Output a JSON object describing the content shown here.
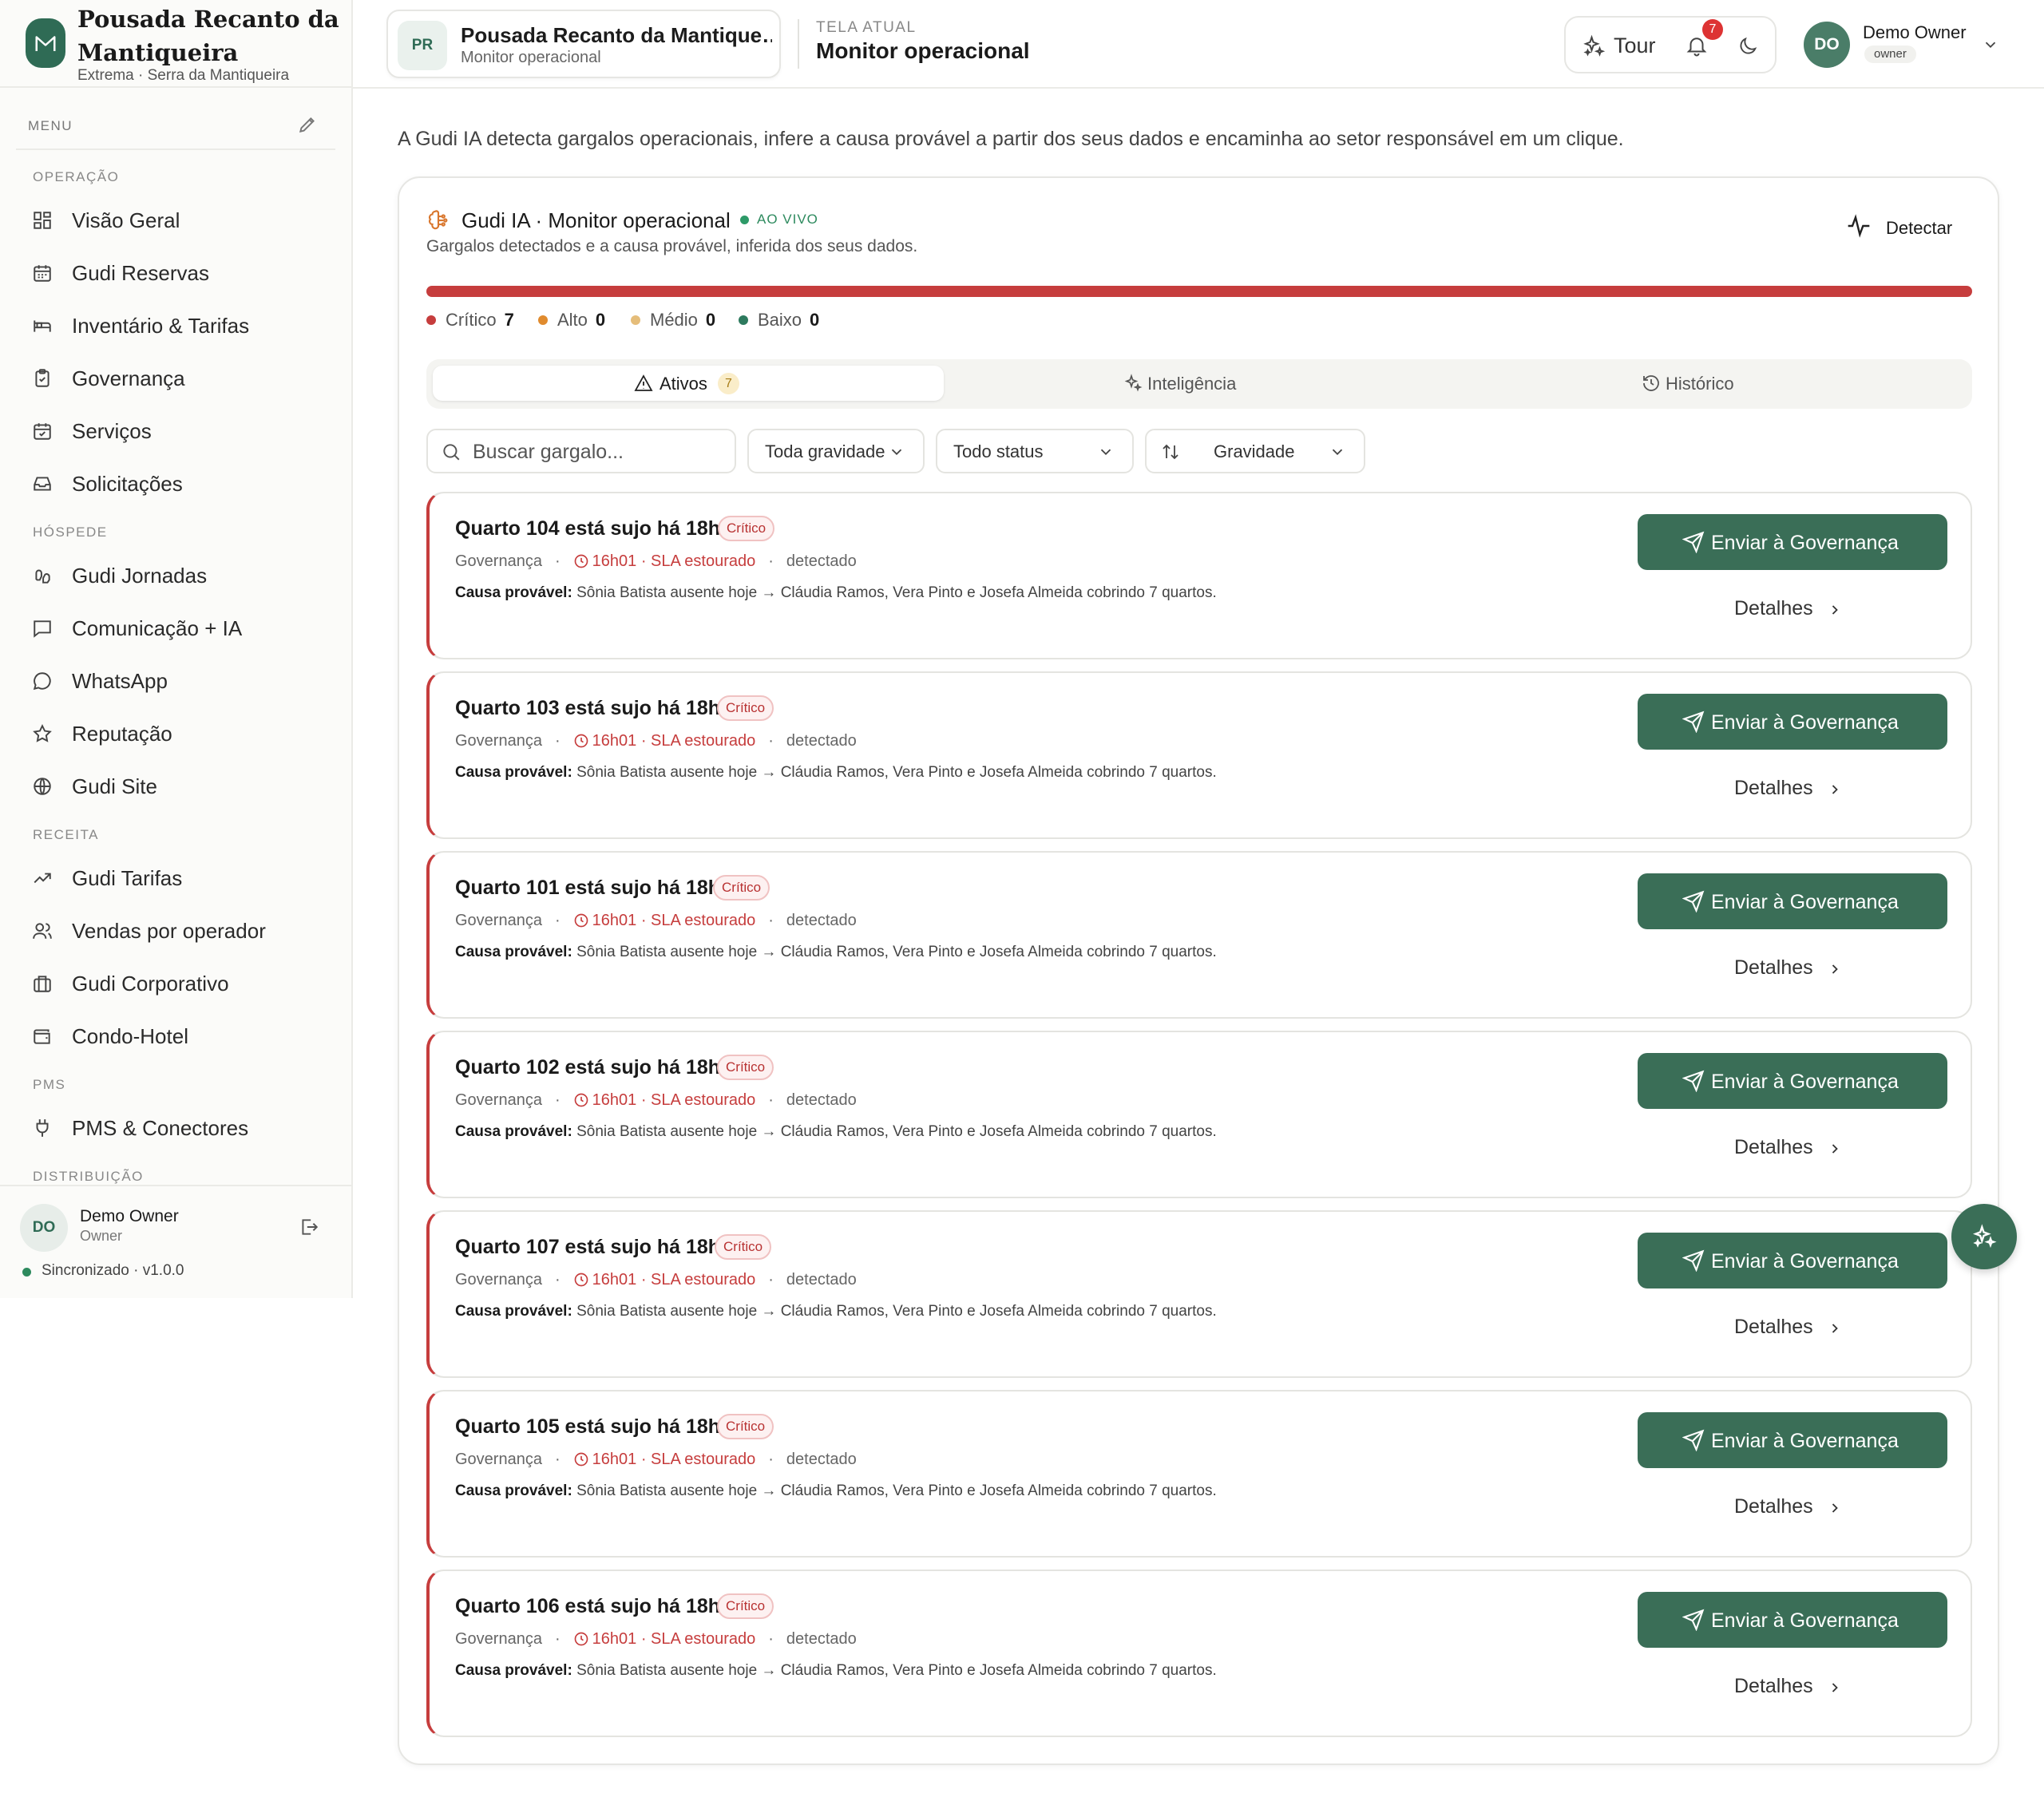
{
  "brand": {
    "name": "Pousada Recanto da Mantiqueira",
    "location": "Extrema · Serra da Mantiqueira"
  },
  "sidebar": {
    "menu_label": "MENU",
    "sections": {
      "operacao": "OPERAÇÃO",
      "hospede": "HÓSPEDE",
      "receita": "RECEITA",
      "pms": "PMS",
      "distribuicao": "DISTRIBUIÇÃO"
    },
    "items": [
      {
        "label": "Visão Geral",
        "icon": "grid-icon"
      },
      {
        "label": "Gudi Reservas",
        "icon": "calendar-icon"
      },
      {
        "label": "Inventário & Tarifas",
        "icon": "bed-icon"
      },
      {
        "label": "Governança",
        "icon": "clipboard-icon"
      },
      {
        "label": "Serviços",
        "icon": "calendar-check-icon"
      },
      {
        "label": "Solicitações",
        "icon": "inbox-icon"
      },
      {
        "label": "Gudi Jornadas",
        "icon": "footprints-icon"
      },
      {
        "label": "Comunicação + IA",
        "icon": "message-square-icon"
      },
      {
        "label": "WhatsApp",
        "icon": "message-circle-icon"
      },
      {
        "label": "Reputação",
        "icon": "star-icon"
      },
      {
        "label": "Gudi Site",
        "icon": "globe-icon"
      },
      {
        "label": "Gudi Tarifas",
        "icon": "trending-up-icon"
      },
      {
        "label": "Vendas por operador",
        "icon": "users-icon"
      },
      {
        "label": "Gudi Corporativo",
        "icon": "building-icon"
      },
      {
        "label": "Condo-Hotel",
        "icon": "wallet-icon"
      },
      {
        "label": "PMS & Conectores",
        "icon": "plug-icon"
      }
    ],
    "user": {
      "initials": "DO",
      "name": "Demo Owner",
      "role": "Owner"
    },
    "sync_status": "Sincronizado · v1.0.0"
  },
  "header": {
    "property_initials": "PR",
    "property_name": "Pousada Recanto da Mantique…",
    "property_sub": "Monitor operacional",
    "current_screen_label": "TELA ATUAL",
    "current_screen": "Monitor operacional",
    "tour_label": "Tour",
    "notifications_count": "7",
    "user_initials": "DO",
    "user_name": "Demo Owner",
    "user_role": "owner"
  },
  "main": {
    "intro": "A Gudi IA detecta gargalos operacionais, infere a causa provável a partir dos seus dados e encaminha ao setor responsável em um clique.",
    "panel": {
      "title": "Gudi IA · Monitor operacional",
      "live": "AO VIVO",
      "subtitle": "Gargalos detectados e a causa provável, inferida dos seus dados.",
      "detect_label": "Detectar",
      "severity": [
        {
          "label": "Crítico",
          "count": "7",
          "color": "#c63d3d"
        },
        {
          "label": "Alto",
          "count": "0",
          "color": "#e08b2e"
        },
        {
          "label": "Médio",
          "count": "0",
          "color": "#e5bd7a"
        },
        {
          "label": "Baixo",
          "count": "0",
          "color": "#2d7a5e"
        }
      ],
      "tabs": [
        {
          "label": "Ativos",
          "count": "7"
        },
        {
          "label": "Inteligência"
        },
        {
          "label": "Histórico"
        }
      ],
      "search_placeholder": "Buscar gargalo...",
      "filters": {
        "gravity": "Toda gravidade",
        "status": "Todo status",
        "sort": "Gravidade"
      },
      "cards": [
        {
          "title": "Quarto 104 está sujo há 18h19",
          "badge": "Crítico",
          "sector": "Governança",
          "sla": "16h01 · SLA estourado",
          "state": "detectado",
          "cause_label": "Causa provável:",
          "cause": "Sônia Batista ausente hoje → Cláudia Ramos, Vera Pinto e Josefa Almeida cobrindo 7 quartos.",
          "action": "Enviar à Governança",
          "details": "Detalhes"
        },
        {
          "title": "Quarto 103 está sujo há 18h19",
          "badge": "Crítico",
          "sector": "Governança",
          "sla": "16h01 · SLA estourado",
          "state": "detectado",
          "cause_label": "Causa provável:",
          "cause": "Sônia Batista ausente hoje → Cláudia Ramos, Vera Pinto e Josefa Almeida cobrindo 7 quartos.",
          "action": "Enviar à Governança",
          "details": "Detalhes"
        },
        {
          "title": "Quarto 101 está sujo há 18h19",
          "badge": "Crítico",
          "sector": "Governança",
          "sla": "16h01 · SLA estourado",
          "state": "detectado",
          "cause_label": "Causa provável:",
          "cause": "Sônia Batista ausente hoje → Cláudia Ramos, Vera Pinto e Josefa Almeida cobrindo 7 quartos.",
          "action": "Enviar à Governança",
          "details": "Detalhes"
        },
        {
          "title": "Quarto 102 está sujo há 18h19",
          "badge": "Crítico",
          "sector": "Governança",
          "sla": "16h01 · SLA estourado",
          "state": "detectado",
          "cause_label": "Causa provável:",
          "cause": "Sônia Batista ausente hoje → Cláudia Ramos, Vera Pinto e Josefa Almeida cobrindo 7 quartos.",
          "action": "Enviar à Governança",
          "details": "Detalhes"
        },
        {
          "title": "Quarto 107 está sujo há 18h19",
          "badge": "Crítico",
          "sector": "Governança",
          "sla": "16h01 · SLA estourado",
          "state": "detectado",
          "cause_label": "Causa provável:",
          "cause": "Sônia Batista ausente hoje → Cláudia Ramos, Vera Pinto e Josefa Almeida cobrindo 7 quartos.",
          "action": "Enviar à Governança",
          "details": "Detalhes"
        },
        {
          "title": "Quarto 105 está sujo há 18h19",
          "badge": "Crítico",
          "sector": "Governança",
          "sla": "16h01 · SLA estourado",
          "state": "detectado",
          "cause_label": "Causa provável:",
          "cause": "Sônia Batista ausente hoje → Cláudia Ramos, Vera Pinto e Josefa Almeida cobrindo 7 quartos.",
          "action": "Enviar à Governança",
          "details": "Detalhes"
        },
        {
          "title": "Quarto 106 está sujo há 18h19",
          "badge": "Crítico",
          "sector": "Governança",
          "sla": "16h01 · SLA estourado",
          "state": "detectado",
          "cause_label": "Causa provável:",
          "cause": "Sônia Batista ausente hoje → Cláudia Ramos, Vera Pinto e Josefa Almeida cobrindo 7 quartos.",
          "action": "Enviar à Governança",
          "details": "Detalhes"
        }
      ]
    }
  },
  "colors": {
    "brand": "#2f6b55",
    "primary_button": "#3a6e57",
    "critical": "#c63d3d"
  }
}
